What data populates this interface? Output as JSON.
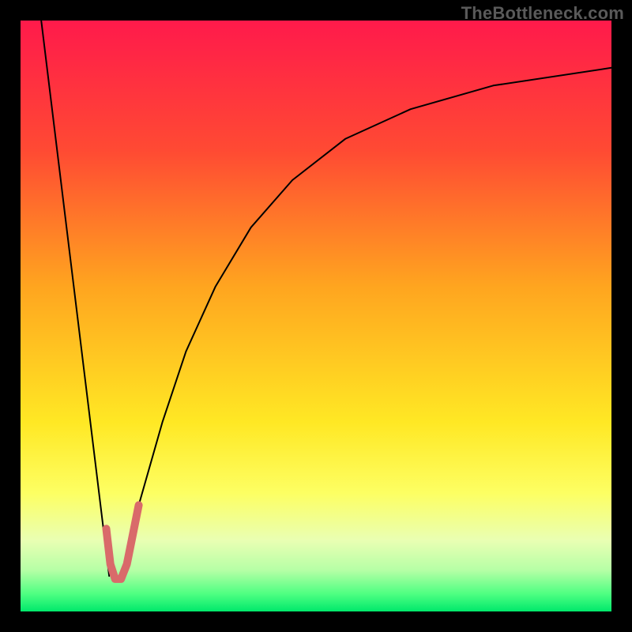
{
  "watermark": "TheBottleneck.com",
  "chart_data": {
    "type": "line",
    "title": "",
    "xlabel": "",
    "ylabel": "",
    "xlim": [
      0,
      100
    ],
    "ylim": [
      0,
      100
    ],
    "gradient_stops": [
      {
        "offset": 0,
        "color": "#ff1a4b"
      },
      {
        "offset": 22,
        "color": "#ff4a33"
      },
      {
        "offset": 45,
        "color": "#ffa51f"
      },
      {
        "offset": 68,
        "color": "#ffe824"
      },
      {
        "offset": 80,
        "color": "#fdff63"
      },
      {
        "offset": 88,
        "color": "#e9ffb3"
      },
      {
        "offset": 93,
        "color": "#b6ffa6"
      },
      {
        "offset": 97,
        "color": "#4fff82"
      },
      {
        "offset": 100,
        "color": "#00e86b"
      }
    ],
    "series": [
      {
        "name": "left-falling-line",
        "x": [
          3.5,
          15.0
        ],
        "values": [
          100,
          6
        ],
        "stroke": "#000000",
        "width": 2
      },
      {
        "name": "right-rising-curve",
        "x": [
          17.0,
          20,
          24,
          28,
          33,
          39,
          46,
          55,
          66,
          80,
          100
        ],
        "values": [
          6,
          18,
          32,
          44,
          55,
          65,
          73,
          80,
          85,
          89,
          92
        ],
        "stroke": "#000000",
        "width": 2
      },
      {
        "name": "pink-dip-marker",
        "x": [
          14.5,
          15.2,
          16.0,
          17.0,
          18.0,
          19.0,
          20.0
        ],
        "values": [
          14,
          8,
          5.5,
          5.5,
          8,
          13,
          18
        ],
        "stroke": "#d96a6a",
        "width": 10
      }
    ]
  }
}
